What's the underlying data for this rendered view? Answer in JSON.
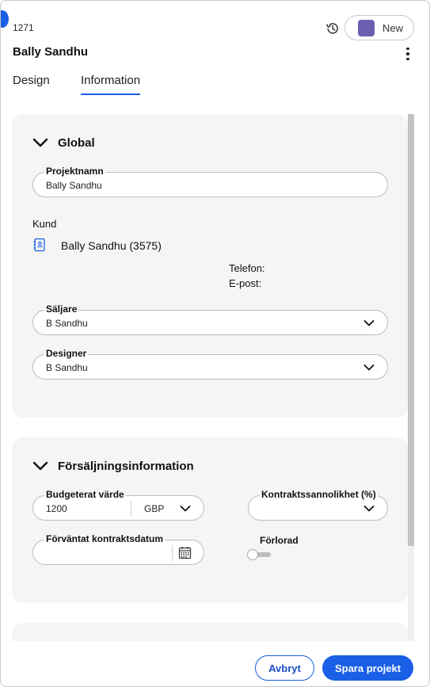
{
  "header": {
    "project_id": "1271",
    "project_name": "Bally Sandhu",
    "new_button_label": "New",
    "new_swatch_color": "#6a5fb0"
  },
  "tabs": [
    {
      "label": "Design",
      "active": false
    },
    {
      "label": "Information",
      "active": true
    }
  ],
  "global": {
    "title": "Global",
    "project_name_field": {
      "label": "Projektnamn",
      "value": "Bally Sandhu"
    },
    "customer": {
      "label": "Kund",
      "icon": "contact-book-icon",
      "name": "Bally Sandhu (3575)",
      "phone_label": "Telefon:",
      "email_label": "E-post:"
    },
    "seller_field": {
      "label": "Säljare",
      "value": "B Sandhu"
    },
    "designer_field": {
      "label": "Designer",
      "value": "B Sandhu"
    }
  },
  "sales": {
    "title": "Försäljningsinformation",
    "budget_field": {
      "label": "Budgeterat värde",
      "value": "1200",
      "currency": "GBP"
    },
    "probability_field": {
      "label": "Kontraktssannolikhet (%)",
      "value": ""
    },
    "expected_date_field": {
      "label": "Förväntat kontraktsdatum",
      "value": ""
    },
    "lost": {
      "label": "Förlorad",
      "checked": false
    }
  },
  "footer": {
    "cancel_label": "Avbryt",
    "save_label": "Spara projekt"
  },
  "colors": {
    "accent": "#1a5fe6",
    "card_background": "#f6f5f3"
  }
}
